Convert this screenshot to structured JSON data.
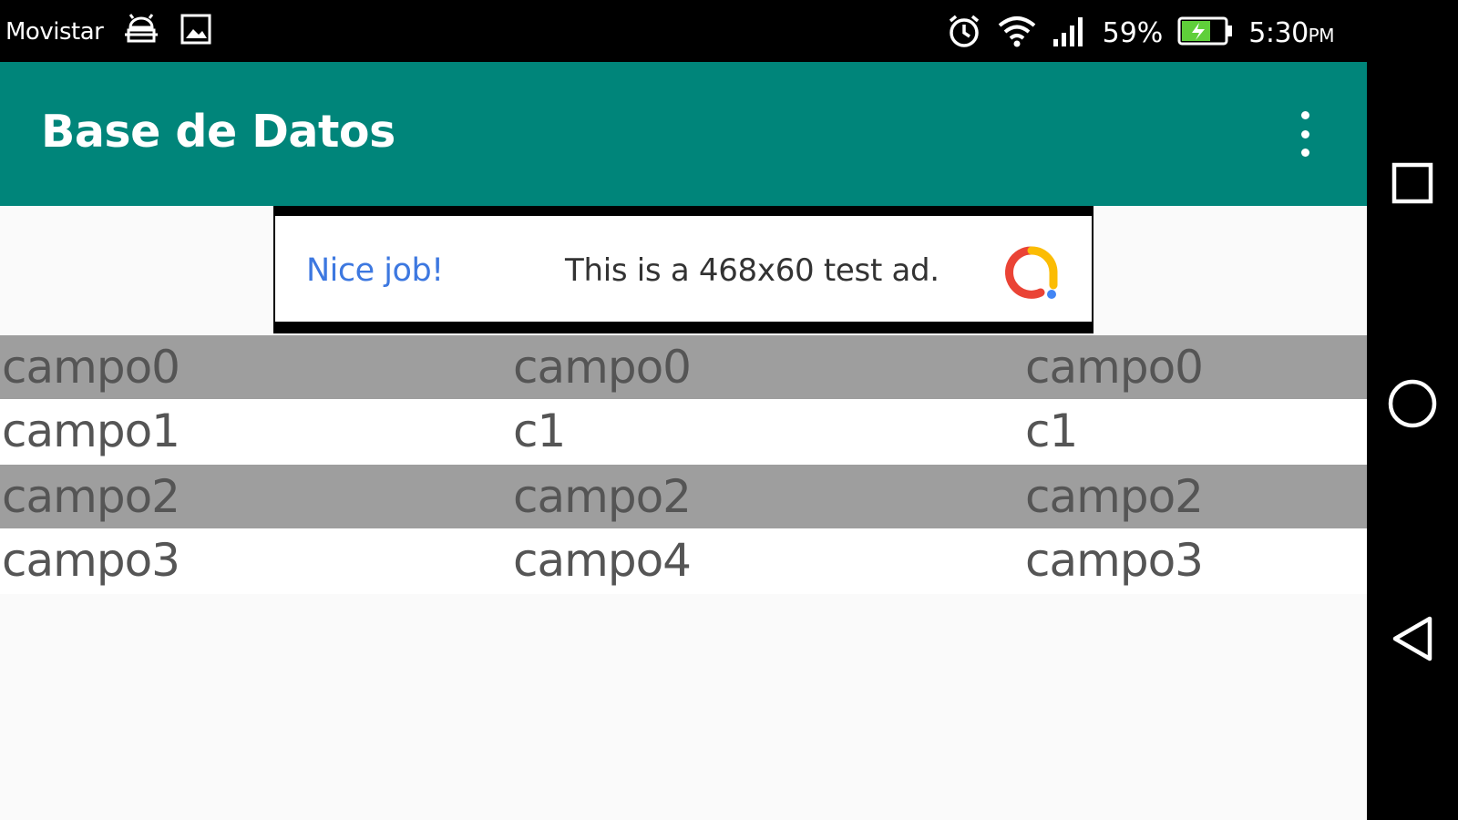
{
  "status_bar": {
    "carrier": "Movistar",
    "battery_percent": "59%",
    "time": "5:30",
    "time_suffix": "PM",
    "icons": [
      "android-debug-icon",
      "image-icon",
      "alarm-icon",
      "wifi-icon",
      "signal-icon",
      "battery-charging-icon"
    ]
  },
  "app_bar": {
    "title": "Base de Datos",
    "overflow_icon": "more-vert-icon"
  },
  "ad": {
    "headline": "Nice job!",
    "body": "This is a 468x60 test ad.",
    "logo_icon": "ad-choices-logo",
    "colors": {
      "headline": "#3d78e0"
    }
  },
  "table": {
    "rows": [
      [
        "campo0",
        "campo0",
        "campo0"
      ],
      [
        "campo1",
        "c1",
        "c1"
      ],
      [
        "campo2",
        "campo2",
        "campo2"
      ],
      [
        "campo3",
        "campo4",
        "campo3"
      ]
    ]
  },
  "nav_bar": {
    "buttons": [
      "recents-square-icon",
      "home-circle-icon",
      "back-triangle-icon"
    ]
  },
  "colors": {
    "app_bar": "#00857a",
    "shaded_row": "#9e9e9e",
    "background": "#fafafa"
  }
}
